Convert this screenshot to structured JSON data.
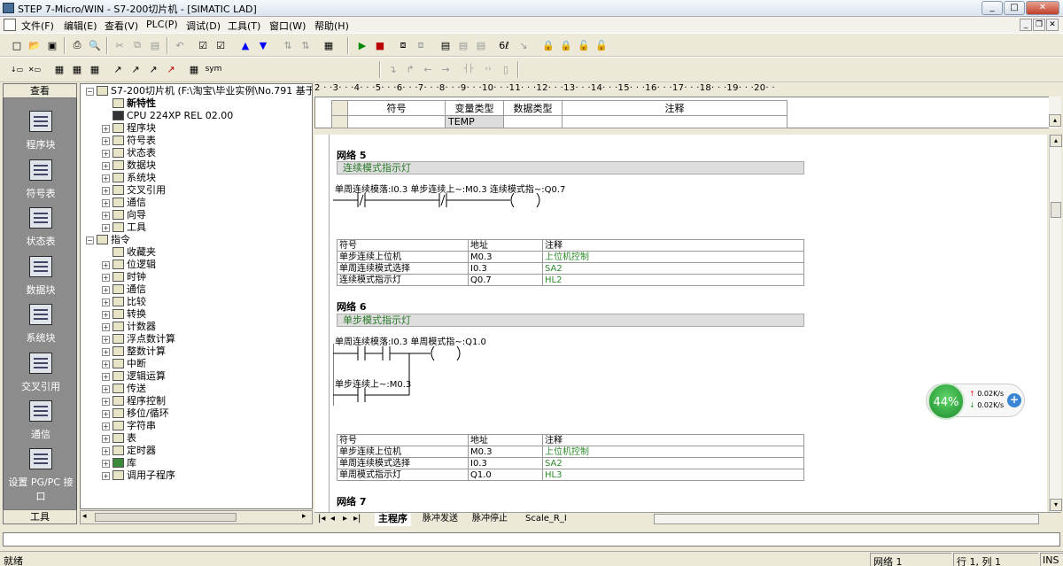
{
  "window": {
    "title": "STEP 7-Micro/WIN - S7-200切片机 - [SIMATIC LAD]",
    "min": "_",
    "max": "□",
    "close": "✕"
  },
  "menu": [
    "文件(F)",
    "编辑(E)",
    "查看(V)",
    "PLC(P)",
    "调试(D)",
    "工具(T)",
    "窗口(W)",
    "帮助(H)"
  ],
  "nav": {
    "header": "查看",
    "footer": "工具",
    "items": [
      "程序块",
      "符号表",
      "状态表",
      "数据块",
      "系统块",
      "交叉引用",
      "通信",
      "设置 PG/PC 接口"
    ]
  },
  "tree": {
    "root": "S7-200切片机 (F:\\淘宝\\毕业实例\\No.791 基于S7-",
    "items": [
      "新特性",
      "CPU 224XP REL 02.00",
      "程序块",
      "符号表",
      "状态表",
      "数据块",
      "系统块",
      "交叉引用",
      "通信",
      "向导",
      "工具",
      "指令",
      "收藏夹",
      "位逻辑",
      "时钟",
      "通信",
      "比较",
      "转换",
      "计数器",
      "浮点数计算",
      "整数计算",
      "中断",
      "逻辑运算",
      "传送",
      "程序控制",
      "移位/循环",
      "字符串",
      "表",
      "定时器",
      "库",
      "调用子程序"
    ]
  },
  "ruler": "2 · ·3· · ·4· · ·5· · ·6· · ·7· · ·8· · ·9· · ·10· · ·11· · ·12· · ·13· · ·14· · ·15· · ·16· · ·17· · ·18· · ·19· · ·20· ·",
  "vartable": {
    "headers": [
      "符号",
      "变量类型",
      "数据类型",
      "注释"
    ],
    "row": "TEMP"
  },
  "networks": [
    {
      "title": "网络 5",
      "comment": "连续模式指示灯",
      "rung": "单周连续模落:I0.3  单步连续上~:M0.3  连续模式指~:Q0.7",
      "symhdr": [
        "符号",
        "地址",
        "注释"
      ],
      "rows": [
        [
          "单步连续上位机",
          "M0.3",
          "上位机控制"
        ],
        [
          "单周连续模式选择",
          "I0.3",
          "SA2"
        ],
        [
          "连续模式指示灯",
          "Q0.7",
          "HL2"
        ]
      ]
    },
    {
      "title": "网络 6",
      "comment": "单步模式指示灯",
      "rung": "单周连续模落:I0.3  单周模式指~:Q1.0",
      "rung2": "单步连续上~:M0.3",
      "symhdr": [
        "符号",
        "地址",
        "注释"
      ],
      "rows": [
        [
          "单步连续上位机",
          "M0.3",
          "上位机控制"
        ],
        [
          "单周连续模式选择",
          "I0.3",
          "SA2"
        ],
        [
          "单周模式指示灯",
          "Q1.0",
          "HL3"
        ]
      ]
    },
    {
      "title": "网络 7"
    }
  ],
  "tabs": [
    "主程序",
    "脉冲发送",
    "脉冲停止",
    "Scale_R_I"
  ],
  "status": {
    "left": "就绪",
    "network": "网络 1",
    "pos": "行 1, 列 1",
    "mode": "INS"
  },
  "netwidget": {
    "percent": "44%",
    "up": "0.02K/s",
    "down": "0.02K/s"
  }
}
